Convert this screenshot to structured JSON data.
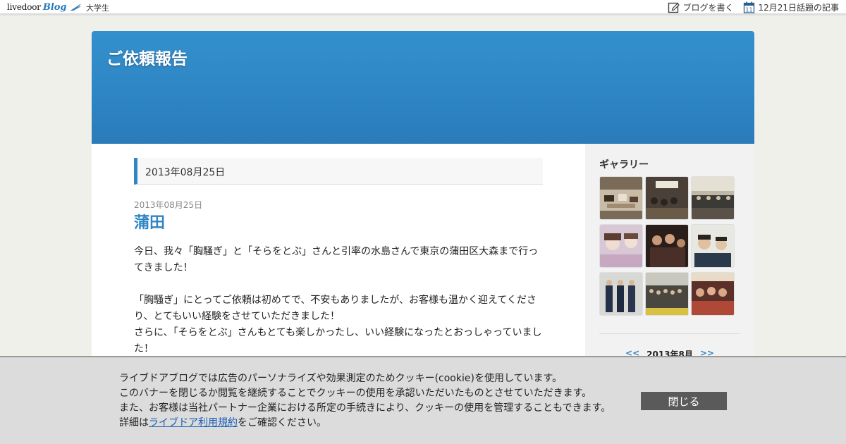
{
  "topbar": {
    "logo_text": "livedoor",
    "logo_blog": "Blog",
    "category": "大学生",
    "write_blog": "ブログを書く",
    "calendar_day": "11",
    "topic_articles": "12月21日話題の記事"
  },
  "header": {
    "blog_title": "ご依頼報告"
  },
  "main": {
    "date_header": "2013年08月25日",
    "article": {
      "date": "2013年08月25日",
      "title": "蒲田",
      "paragraphs": [
        "今日、我々「胸騒ぎ」と「そらをとぶ」さんと引率の水島さんで東京の蒲田区大森まで行ってきました！",
        "",
        "「胸騒ぎ」にとってご依頼は初めてで、不安もありましたが、お客様も温かく迎えてくださり、とてもいい経験をさせていただきました！",
        "さらに、「そらをとぶ」さんもとても楽しかったし、いい経験になったとおっしゃっていました！"
      ]
    }
  },
  "sidebar": {
    "gallery_title": "ギャラリー",
    "thumbnails": [
      "photo-thumbnail",
      "photo-thumbnail",
      "photo-thumbnail",
      "photo-thumbnail",
      "photo-thumbnail",
      "photo-thumbnail",
      "photo-thumbnail",
      "photo-thumbnail",
      "photo-thumbnail"
    ],
    "calendar": {
      "prev": "<<",
      "month": "2013年8月",
      "next": ">>"
    }
  },
  "cookie_banner": {
    "line1": "ライブドアブログでは広告のパーソナライズや効果測定のためクッキー(cookie)を使用しています。",
    "line2": "このバナーを閉じるか閲覧を継続することでクッキーの使用を承認いただいたものとさせていただきます。",
    "line3": "また、お客様は当社パートナー企業における所定の手続きにより、クッキーの使用を管理することもできます。",
    "line4_prefix": "詳細は",
    "line4_link": "ライブドア利用規約",
    "line4_suffix": "をご確認ください。",
    "close_label": "閉じる"
  },
  "colors": {
    "accent": "#2e86c4",
    "header_gradient_top": "#3390cc",
    "header_gradient_bottom": "#2a7bb9",
    "banner_bg": "#dcdcdc",
    "close_button": "#5a5a5a"
  }
}
